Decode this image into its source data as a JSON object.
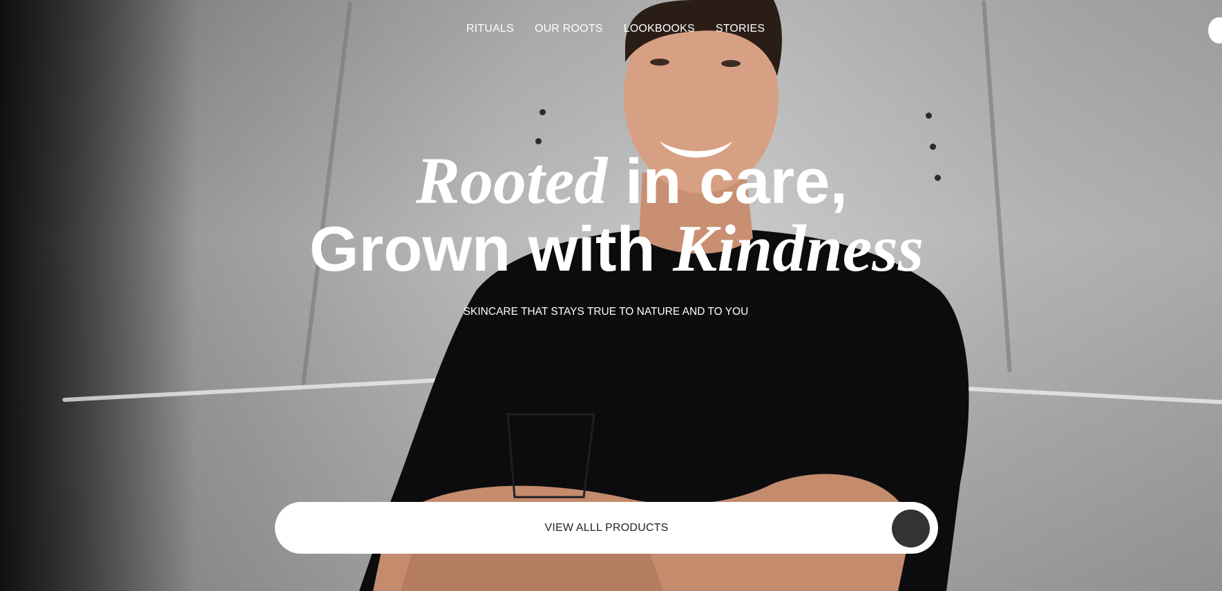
{
  "nav": {
    "items": [
      {
        "label": "RITUALS"
      },
      {
        "label": "OUR ROOTS"
      },
      {
        "label": "LOOKBOOKS"
      },
      {
        "label": "STORIES"
      }
    ]
  },
  "hero": {
    "headline_line1_italic": "Rooted",
    "headline_line1_rest": " in care,",
    "headline_line2_start": "Grown with ",
    "headline_line2_italic": "Kindness",
    "subtitle": "SKINCARE THAT STAYS TRUE TO NATURE AND TO YOU",
    "cta_label": "VIEW ALLL PRODUCTS"
  },
  "colors": {
    "text": "#ffffff",
    "cta_background": "#ffffff",
    "cta_text": "#222222",
    "cta_circle": "#333333"
  }
}
